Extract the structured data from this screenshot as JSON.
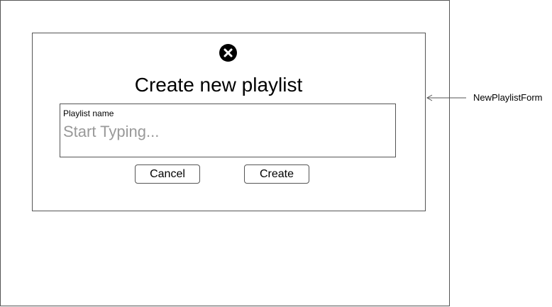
{
  "dialog": {
    "title": "Create new playlist",
    "close_icon": "close-circle-icon"
  },
  "playlist_field": {
    "label": "Playlist name",
    "placeholder": "Start Typing...",
    "value": ""
  },
  "buttons": {
    "cancel_label": "Cancel",
    "create_label": "Create"
  },
  "annotation": {
    "label": "NewPlaylistForm",
    "arrow_icon": "arrow-left-icon"
  },
  "colors": {
    "stroke": "#555555",
    "close_fill": "#000000",
    "placeholder": "#999999"
  }
}
